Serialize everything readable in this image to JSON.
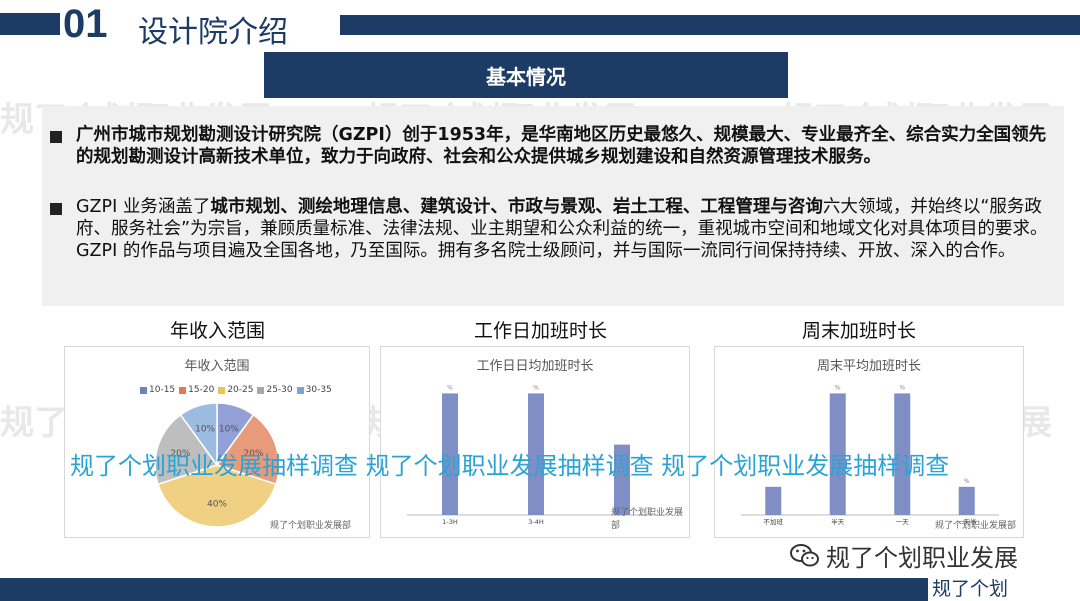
{
  "header": {
    "number": "01",
    "title": "设计院介绍",
    "section": "基本情况"
  },
  "paragraphs": {
    "p1": "广州市城市规划勘测设计研究院（GZPI）创于1953年，是华南地区历史最悠久、规模最大、专业最齐全、综合实力全国领先的规划勘测设计高新技术单位，致力于向政府、社会和公众提供城乡规划建设和自然资源管理技术服务。",
    "p2_a": "GZPI 业务涵盖了",
    "p2_b": "城市规划、测绘地理信息、建筑设计、市政与景观、岩土工程、工程管理与咨询",
    "p2_c": "六大领域，并始终以“服务政府、服务社会”为宗旨，兼顾质量标准、法律法规、业主期望和公众利益的统一，重视城市空间和地域文化对具体项目的要求。GZPI 的作品与项目遍及全国各地，乃至国际。拥有多名院士级顾问，并与国际一流同行间保持持续、开放、深入的合作。"
  },
  "charts": {
    "c1_heading": "年收入范围",
    "c2_heading": "工作日加班时长",
    "c3_heading": "周末加班时长",
    "c1_inner": "年收入范围",
    "c2_inner": "工作日日均加班时长",
    "c3_inner": "周末平均加班时长",
    "footer_text": "规了个划职业发展部",
    "legend": [
      "10-15",
      "15-20",
      "20-25",
      "25-30",
      "30-35"
    ]
  },
  "chart_data": [
    {
      "type": "pie",
      "title": "年收入范围",
      "categories": [
        "10-15",
        "15-20",
        "20-25",
        "25-30",
        "30-35"
      ],
      "values": [
        10,
        20,
        40,
        20,
        10
      ],
      "labels": [
        "10%",
        "20%",
        "40%",
        "20%",
        "10%"
      ],
      "colors": [
        "#6e80c8",
        "#e07a4f",
        "#ebc25a",
        "#a8a8a8",
        "#7aa6d6"
      ]
    },
    {
      "type": "bar",
      "title": "工作日日均加班时长",
      "categories": [
        "1-3H",
        "3-4H",
        ""
      ],
      "values": [
        0.95,
        0.95,
        0.55
      ],
      "value_labels": [
        "%",
        "%",
        ""
      ],
      "color": "#7f8fc6"
    },
    {
      "type": "bar",
      "title": "周末平均加班时长",
      "categories": [
        "不加班",
        "半天",
        "一天",
        "一天半"
      ],
      "values": [
        0.22,
        0.95,
        0.95,
        0.22
      ],
      "value_labels": [
        "",
        "%",
        "%",
        "%"
      ],
      "color": "#7f8fc6"
    }
  ],
  "overlay": {
    "survey": "规了个划职业发展抽样调查  规了个划职业发展抽样调查  规了个划职业发展抽样调查",
    "wechat": "规了个划职业发展",
    "footer_tag": "规了个划",
    "watermark": "规了个划职业发展"
  }
}
